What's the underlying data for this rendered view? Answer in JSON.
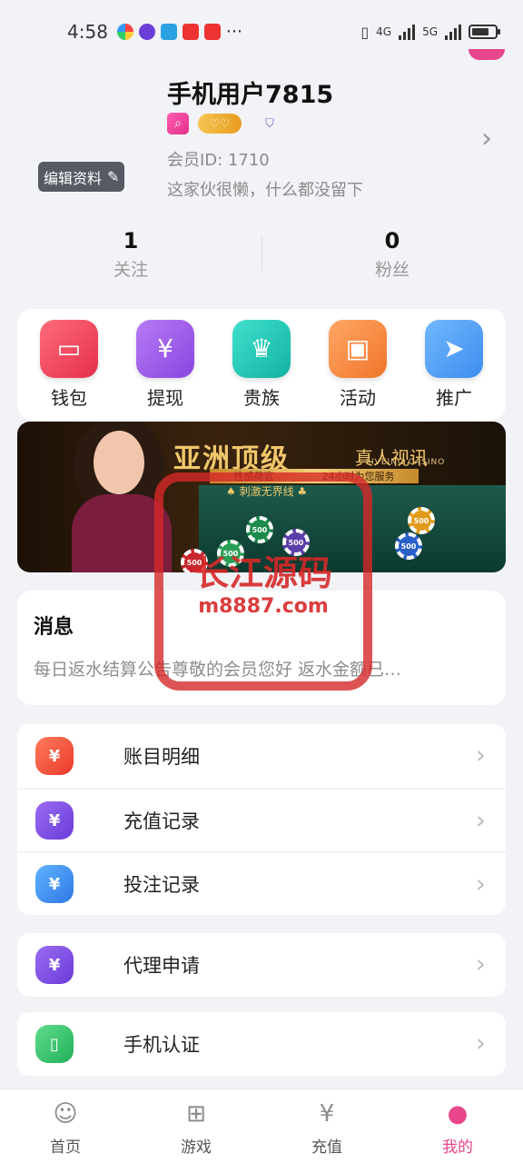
{
  "status_bar": {
    "time": "4:58",
    "dots": "···",
    "net1": "4G",
    "net2": "5G"
  },
  "profile": {
    "username": "手机用户7815",
    "member_id": "会员ID: 1710",
    "bio": "这家伙很懒，什么都没留下",
    "edit_label": "编辑资料"
  },
  "stats": [
    {
      "value": "1",
      "label": "关注"
    },
    {
      "value": "0",
      "label": "粉丝"
    }
  ],
  "quick_actions": [
    {
      "label": "钱包",
      "color": "#f1475d",
      "icon": "wallet-icon"
    },
    {
      "label": "提现",
      "color": "#9a5be8",
      "icon": "money-bag-icon"
    },
    {
      "label": "贵族",
      "color": "#1ec6b4",
      "icon": "crown-icon"
    },
    {
      "label": "活动",
      "color": "#f68c3c",
      "icon": "gift-icon"
    },
    {
      "label": "推广",
      "color": "#4ba0f3",
      "icon": "paper-plane-icon"
    }
  ],
  "banner": {
    "title": "亚洲顶级",
    "subtitle": "真人视讯",
    "en": "LIVEING CASINO",
    "strip_left": "性感荷官",
    "strip_right": "24小时为您服务",
    "line2": "♠ 刺激无界线 ♣",
    "chips": [
      "500",
      "500",
      "500",
      "500",
      "500",
      "500"
    ]
  },
  "messages": {
    "title": "消息",
    "text": "每日返水结算公告尊敬的会员您好  返水金额已…"
  },
  "menu_group1": [
    {
      "label": "账目明细",
      "color": "#f1533d",
      "glyph": "¥",
      "icon": "ledger-icon"
    },
    {
      "label": "充值记录",
      "color": "#7b4fe0",
      "glyph": "¥",
      "icon": "recharge-bag-icon"
    },
    {
      "label": "投注记录",
      "color": "#3b8ef0",
      "glyph": "¥",
      "icon": "coins-icon"
    }
  ],
  "menu_group2": [
    {
      "label": "代理申请",
      "color": "#7b4fe0",
      "glyph": "¥",
      "icon": "agent-bag-icon"
    }
  ],
  "menu_group3": [
    {
      "label": "手机认证",
      "color": "#34c46a",
      "glyph": "▯",
      "icon": "phone-icon"
    }
  ],
  "tabs": [
    {
      "label": "首页",
      "icon": "home-girl-icon",
      "active": false
    },
    {
      "label": "游戏",
      "icon": "gamepad-icon",
      "active": false
    },
    {
      "label": "充值",
      "icon": "yuan-circle-icon",
      "active": false
    },
    {
      "label": "我的",
      "icon": "person-icon",
      "active": true
    }
  ],
  "watermark": {
    "line1": "长江源码",
    "line2": "m8887.com"
  },
  "colors": {
    "accent": "#e8468c",
    "background": "#f2f3f7"
  }
}
